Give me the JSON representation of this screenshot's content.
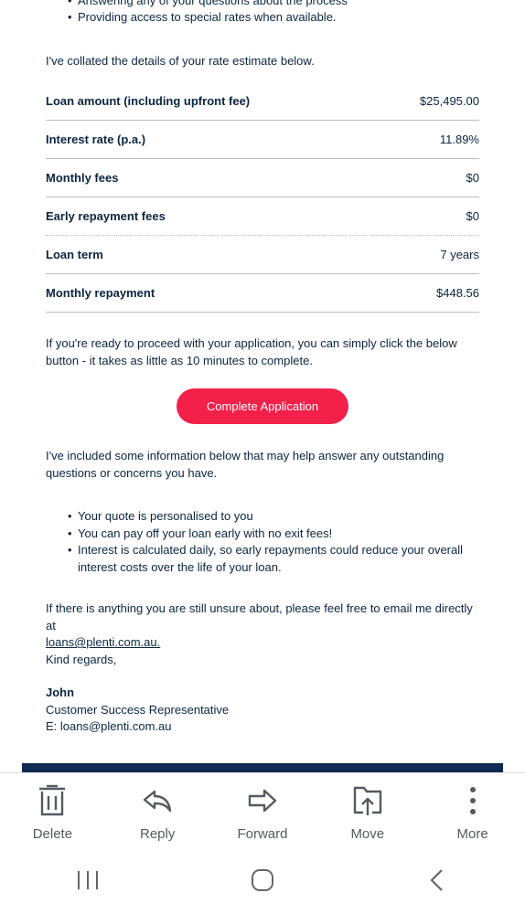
{
  "email": {
    "top_bullets": [
      "Answering any of your questions about the process",
      "Providing access to special rates when available."
    ],
    "intro": "I've collated the details of your rate estimate below.",
    "rates": [
      {
        "label": "Loan amount (including upfront fee)",
        "value": "$25,495.00"
      },
      {
        "label": "Interest rate (p.a.)",
        "value": "11.89%"
      },
      {
        "label": "Monthly fees",
        "value": "$0"
      },
      {
        "label": "Early repayment fees",
        "value": "$0"
      },
      {
        "label": "Loan term",
        "value": "7 years"
      },
      {
        "label": "Monthly repayment",
        "value": "$448.56"
      }
    ],
    "proceed_text": "If you're ready to proceed with your application, you can simply click the below button - it takes as little as 10 minutes to complete.",
    "cta_label": "Complete Application",
    "info_text": "I've included some information below that may help answer any outstanding questions or concerns you have.",
    "info_bullets": [
      "Your quote is personalised to you",
      "You can pay off your loan early with no exit fees!",
      "Interest is calculated daily, so early repayments could reduce your overall interest costs over the life of your loan."
    ],
    "contact_text": "If there is anything you are still unsure about, please feel free to email me directly at",
    "contact_email": "loans@plenti.com.au.",
    "closing": "Kind regards,",
    "signature": {
      "name": "John",
      "title": "Customer Success Representative",
      "email_line": "E: loans@plenti.com.au"
    }
  },
  "actions": {
    "delete": "Delete",
    "reply": "Reply",
    "forward": "Forward",
    "move": "Move",
    "more": "More"
  },
  "colors": {
    "accent": "#f3204a",
    "text": "#0b2540",
    "band": "#0e2a54"
  }
}
